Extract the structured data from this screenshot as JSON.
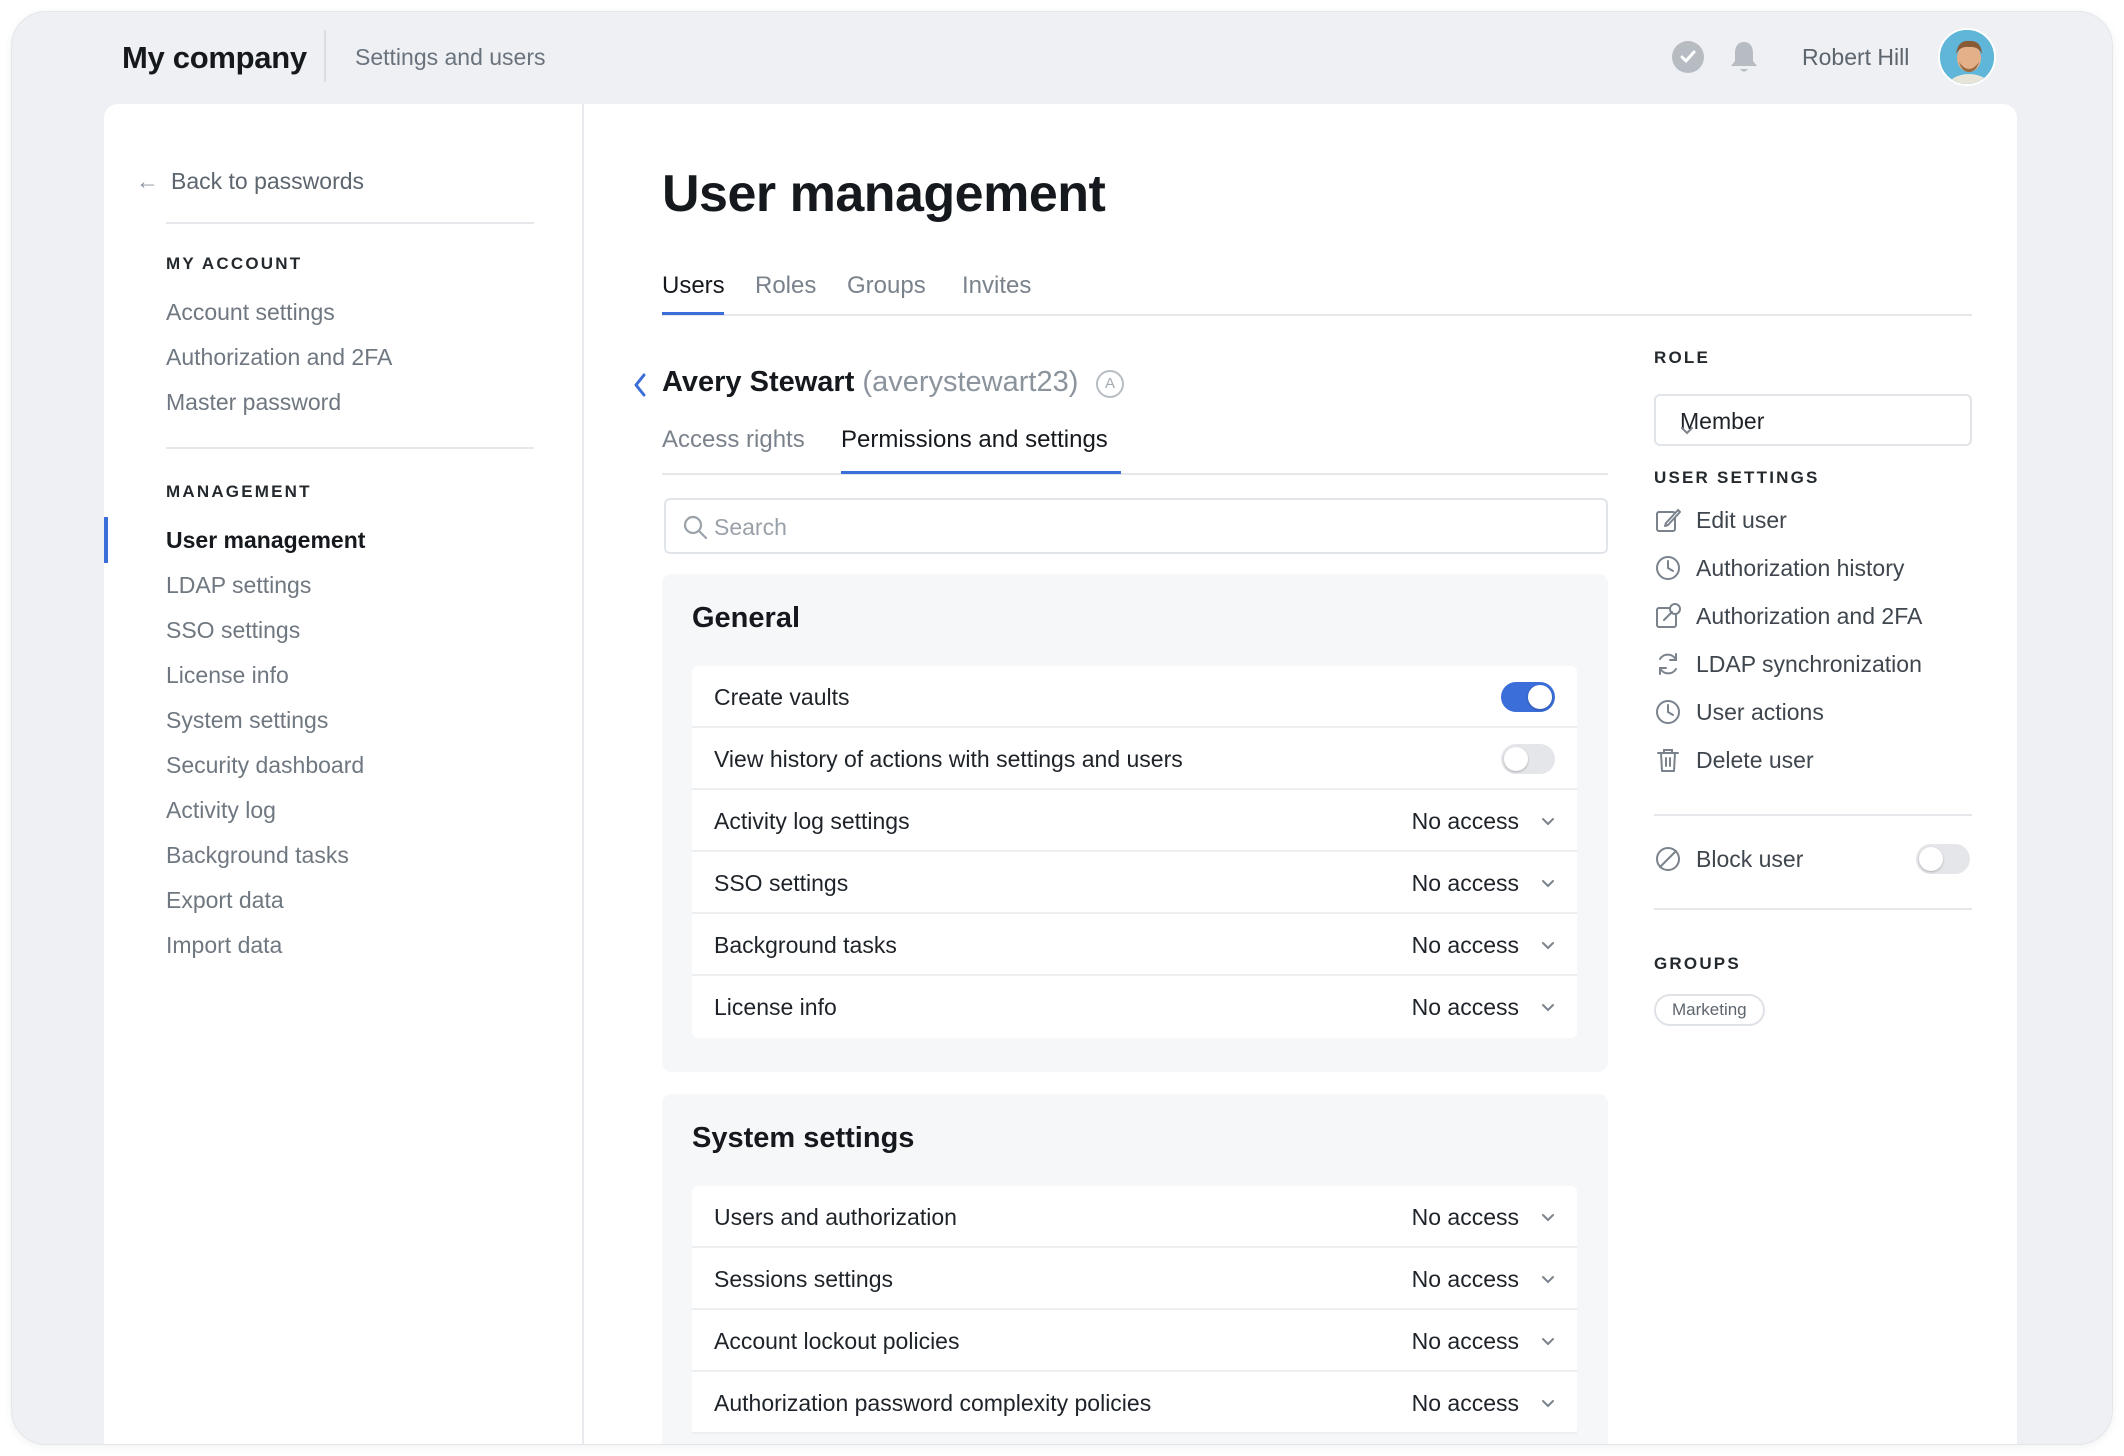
{
  "topbar": {
    "company": "My company",
    "section": "Settings and users",
    "user_name": "Robert Hill",
    "check_icon": "check-circle-icon",
    "bell_icon": "bell-icon"
  },
  "sidebar": {
    "back_label": "Back to passwords",
    "my_account_title": "MY ACCOUNT",
    "my_account": [
      {
        "label": "Account settings"
      },
      {
        "label": "Authorization and 2FA"
      },
      {
        "label": "Master password"
      }
    ],
    "management_title": "MANAGEMENT",
    "management": [
      {
        "label": "User management",
        "active": true
      },
      {
        "label": "LDAP settings"
      },
      {
        "label": "SSO settings"
      },
      {
        "label": "License info"
      },
      {
        "label": "System settings"
      },
      {
        "label": "Security dashboard"
      },
      {
        "label": "Activity log"
      },
      {
        "label": "Background tasks"
      },
      {
        "label": "Export data"
      },
      {
        "label": "Import data"
      }
    ]
  },
  "main": {
    "title": "User management",
    "tabs": [
      {
        "label": "Users",
        "active": true
      },
      {
        "label": "Roles"
      },
      {
        "label": "Groups"
      },
      {
        "label": "Invites"
      }
    ],
    "user": {
      "name": "Avery Stewart",
      "login": "(averystewart23)",
      "badge": "A"
    },
    "subtabs": [
      {
        "label": "Access rights"
      },
      {
        "label": "Permissions and settings",
        "active": true
      }
    ],
    "search_placeholder": "Search",
    "general": {
      "title": "General",
      "rows": [
        {
          "label": "Create vaults",
          "type": "toggle",
          "on": true
        },
        {
          "label": "View history of actions with settings and users",
          "type": "toggle",
          "on": false
        },
        {
          "label": "Activity log settings",
          "type": "select",
          "value": "No access"
        },
        {
          "label": "SSO settings",
          "type": "select",
          "value": "No access"
        },
        {
          "label": "Background tasks",
          "type": "select",
          "value": "No access"
        },
        {
          "label": "License info",
          "type": "select",
          "value": "No access"
        }
      ]
    },
    "system": {
      "title": "System settings",
      "rows": [
        {
          "label": "Users and authorization",
          "type": "select",
          "value": "No access"
        },
        {
          "label": "Sessions settings",
          "type": "select",
          "value": "No access"
        },
        {
          "label": "Account lockout policies",
          "type": "select",
          "value": "No access"
        },
        {
          "label": "Authorization password complexity policies",
          "type": "select",
          "value": "No access"
        }
      ]
    }
  },
  "right": {
    "role_title": "ROLE",
    "role_value": "Member",
    "user_settings_title": "USER SETTINGS",
    "user_settings": [
      {
        "label": "Edit user",
        "icon": "edit-icon"
      },
      {
        "label": "Authorization history",
        "icon": "clock-icon"
      },
      {
        "label": "Authorization and 2FA",
        "icon": "external-link-icon"
      },
      {
        "label": "LDAP synchronization",
        "icon": "sync-icon"
      },
      {
        "label": "User actions",
        "icon": "clock-icon"
      },
      {
        "label": "Delete user",
        "icon": "trash-icon"
      }
    ],
    "block_label": "Block user",
    "block_on": false,
    "groups_title": "GROUPS",
    "groups": [
      "Marketing"
    ]
  },
  "colors": {
    "accent": "#3b6ed8",
    "background": "#eef0f3",
    "panel": "#f6f7f8"
  }
}
